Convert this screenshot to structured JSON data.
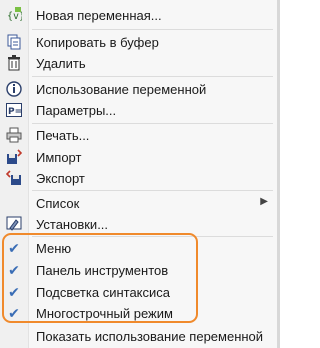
{
  "menu": {
    "items": [
      {
        "label": "Новая переменная...",
        "icon": "variable-icon"
      },
      {
        "label": "Копировать в буфер",
        "icon": "copy-icon"
      },
      {
        "label": "Удалить",
        "icon": "trash-icon"
      },
      {
        "label": "Использование переменной",
        "icon": "info-icon"
      },
      {
        "label": "Параметры...",
        "icon": "parameters-icon"
      },
      {
        "label": "Печать...",
        "icon": "printer-icon"
      },
      {
        "label": "Импорт",
        "icon": "import-icon"
      },
      {
        "label": "Экспорт",
        "icon": "export-icon"
      },
      {
        "label": "Список",
        "icon": "",
        "has_submenu": true
      },
      {
        "label": "Установки...",
        "icon": "settings-icon"
      },
      {
        "label": "Меню",
        "checked": true
      },
      {
        "label": "Панель инструментов",
        "checked": true
      },
      {
        "label": "Подсветка синтаксиса",
        "checked": true
      },
      {
        "label": "Многострочный режим",
        "checked": true
      },
      {
        "label": "Показать использование переменной",
        "checked": false
      }
    ],
    "colors": {
      "highlight": "#f08a2c",
      "check": "#3a6db5"
    }
  }
}
